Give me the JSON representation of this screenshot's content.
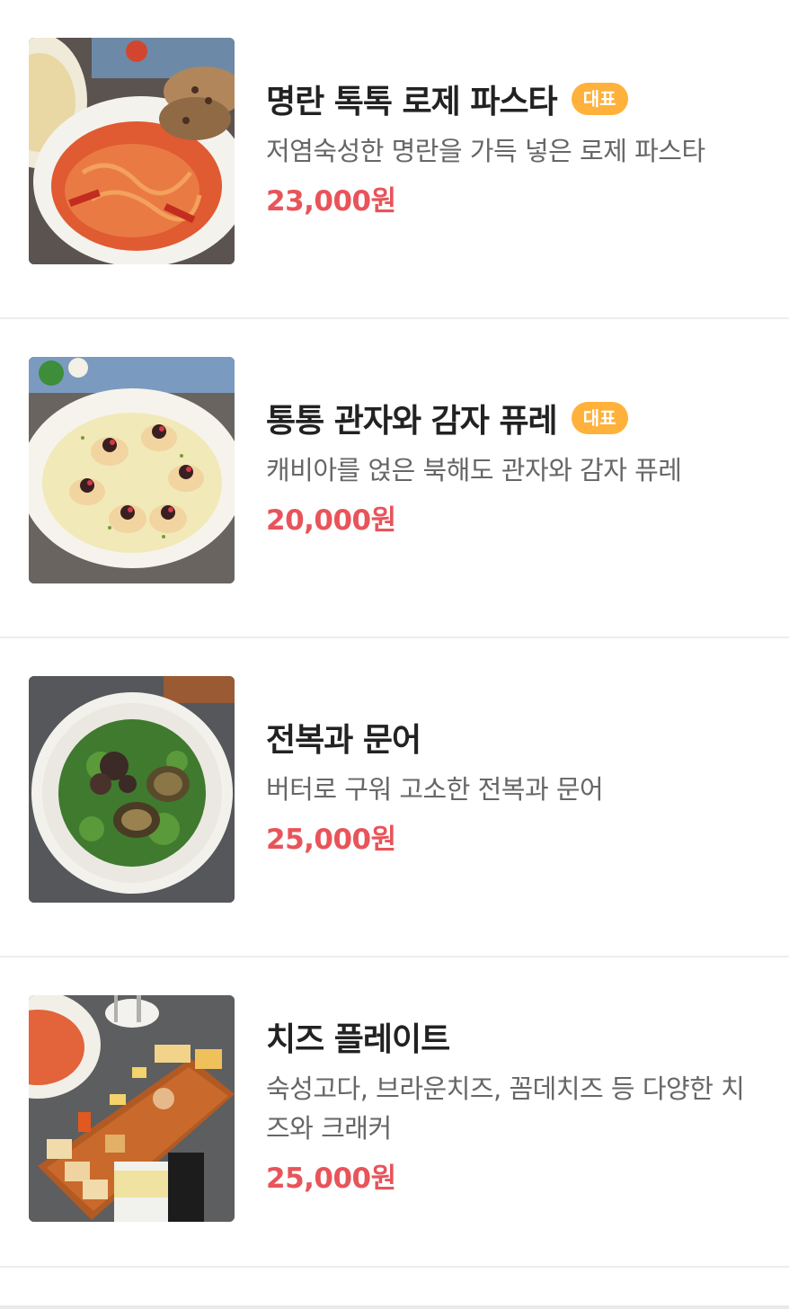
{
  "menu": {
    "items": [
      {
        "name": "명란 톡톡 로제 파스타",
        "badge": "대표",
        "description": "저염숙성한 명란을 가득 넣은 로제 파스타",
        "price": "23,000원"
      },
      {
        "name": "통통 관자와 감자 퓨레",
        "badge": "대표",
        "description": "캐비아를 얹은 북해도 관자와 감자 퓨레",
        "price": "20,000원"
      },
      {
        "name": "전복과 문어",
        "description": "버터로 구워 고소한 전복과 문어",
        "price": "25,000원"
      },
      {
        "name": "치즈 플레이트",
        "description": "숙성고다, 브라운치즈, 꼼데치즈 등 다양한 치즈와 크래커",
        "price": "25,000원"
      }
    ]
  },
  "colors": {
    "price": "#e8545a",
    "badge": "#ffb13b",
    "title": "#222222",
    "description": "#666666",
    "divider": "#ededed"
  },
  "icons": {
    "item_photos": [
      "pasta-photo",
      "scallop-photo",
      "abalone-octopus-photo",
      "cheese-plate-photo"
    ]
  }
}
